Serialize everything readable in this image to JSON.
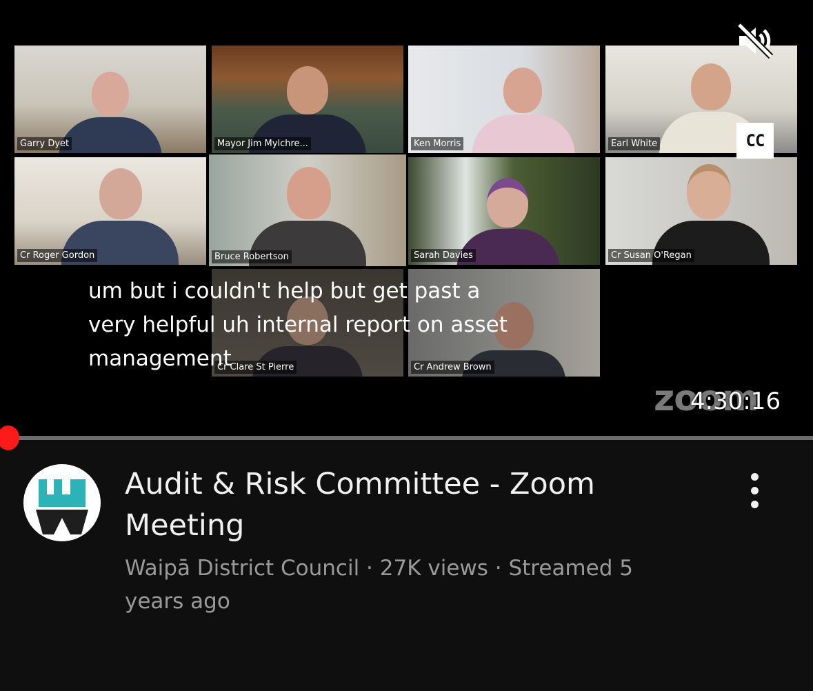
{
  "player": {
    "participants": [
      {
        "name": "Garry Dyet"
      },
      {
        "name": "Mayor Jim Mylchre..."
      },
      {
        "name": "Ken Morris"
      },
      {
        "name": "Earl White"
      },
      {
        "name": "Cr Roger Gordon"
      },
      {
        "name": "Bruce Robertson",
        "active": true
      },
      {
        "name": "Sarah Davies"
      },
      {
        "name": "Cr Susan O'Regan"
      },
      {
        "name": "Cr Clare St Pierre"
      },
      {
        "name": "Cr Andrew Brown"
      }
    ],
    "captions": [
      "um but i couldn't help but get past a",
      "very helpful uh internal report on asset",
      "management"
    ],
    "cc_label": "CC",
    "watermark": "zoom",
    "timestamp": "4:30:16",
    "progress": 0.01,
    "icons": {
      "mute": "volume-muted-icon",
      "cc": "closed-captions-icon",
      "more": "more-vertical-icon"
    }
  },
  "video": {
    "title": "Audit & Risk Committee - Zoom Meeting",
    "meta": "Waipā District Council · 27K views · Streamed 5 years ago",
    "channel_logo_colors": {
      "teal": "#2bb3b8",
      "dark": "#1e1e1e"
    }
  },
  "colors": {
    "progress": "#ff0000",
    "active_speaker": "#7fdb3a",
    "background": "#0f0f0f"
  }
}
